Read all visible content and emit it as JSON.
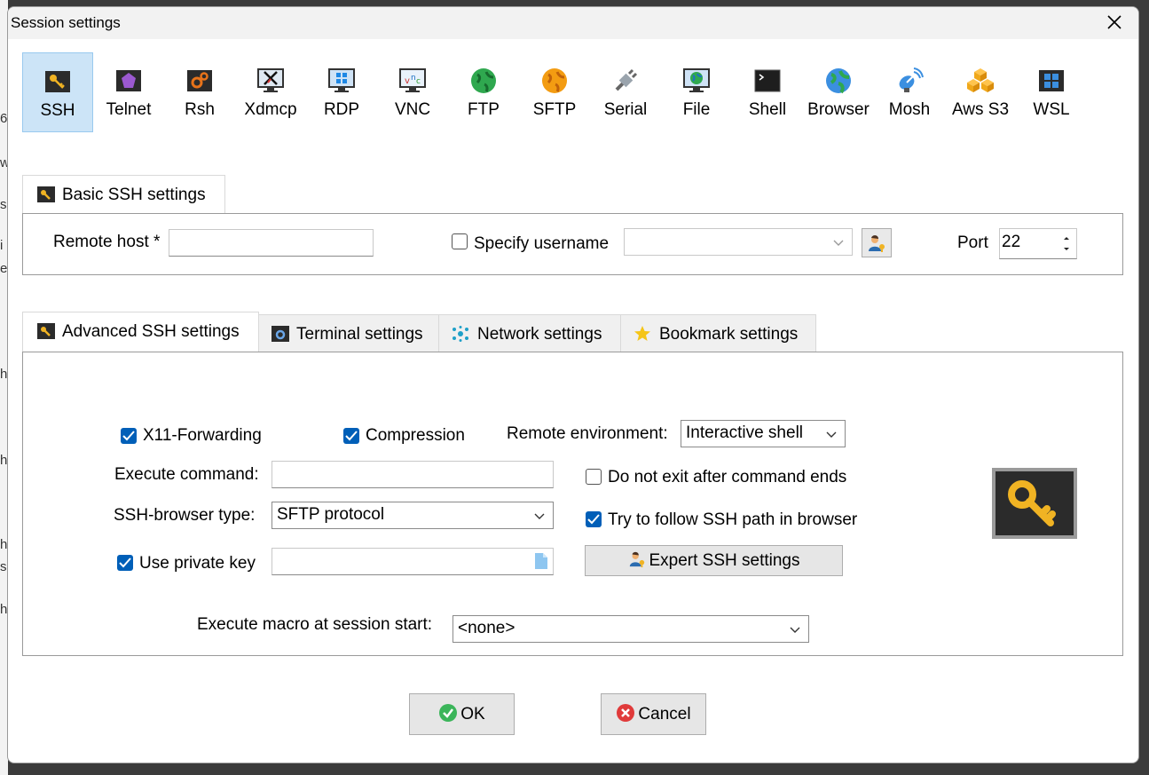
{
  "background": {
    "fragments": [
      "6",
      "w",
      "s",
      "i",
      "e",
      "h",
      "h",
      "h",
      "s",
      "h"
    ]
  },
  "dialog": {
    "title": "Session settings"
  },
  "protocols": [
    {
      "label": "SSH",
      "icon": "ssh-key-icon",
      "selected": true
    },
    {
      "label": "Telnet",
      "icon": "telnet-icon"
    },
    {
      "label": "Rsh",
      "icon": "rsh-icon"
    },
    {
      "label": "Xdmcp",
      "icon": "xdmcp-icon"
    },
    {
      "label": "RDP",
      "icon": "rdp-icon"
    },
    {
      "label": "VNC",
      "icon": "vnc-icon"
    },
    {
      "label": "FTP",
      "icon": "ftp-globe-icon"
    },
    {
      "label": "SFTP",
      "icon": "sftp-globe-icon"
    },
    {
      "label": "Serial",
      "icon": "serial-plug-icon"
    },
    {
      "label": "File",
      "icon": "file-monitor-icon"
    },
    {
      "label": "Shell",
      "icon": "shell-terminal-icon"
    },
    {
      "label": "Browser",
      "icon": "browser-globe-icon"
    },
    {
      "label": "Mosh",
      "icon": "mosh-satellite-icon"
    },
    {
      "label": "Aws S3",
      "icon": "aws-s3-icon"
    },
    {
      "label": "WSL",
      "icon": "wsl-windows-icon"
    }
  ],
  "basic": {
    "tab_label": "Basic SSH settings",
    "remote_host_label": "Remote host *",
    "remote_host_value": "",
    "specify_username_label": "Specify username",
    "specify_username_checked": false,
    "username_value": "",
    "port_label": "Port",
    "port_value": "22"
  },
  "tabs": [
    {
      "label": "Advanced SSH settings",
      "active": true
    },
    {
      "label": "Terminal settings"
    },
    {
      "label": "Network settings"
    },
    {
      "label": "Bookmark settings"
    }
  ],
  "advanced": {
    "x11_label": "X11-Forwarding",
    "x11_checked": true,
    "compression_label": "Compression",
    "compression_checked": true,
    "remote_env_label": "Remote environment:",
    "remote_env_value": "Interactive shell",
    "execute_command_label": "Execute command:",
    "execute_command_value": "",
    "no_exit_label": "Do not exit after command ends",
    "no_exit_checked": false,
    "browser_type_label": "SSH-browser type:",
    "browser_type_value": "SFTP protocol",
    "follow_path_label": "Try to follow SSH path in browser",
    "follow_path_checked": true,
    "private_key_label": "Use private key",
    "private_key_checked": true,
    "private_key_value": "",
    "expert_button": "Expert SSH settings",
    "macro_label": "Execute macro at session start:",
    "macro_value": "<none>"
  },
  "buttons": {
    "ok": "OK",
    "cancel": "Cancel"
  },
  "colors": {
    "accent": "#005fb8",
    "selected_bg": "#cce4f7",
    "key_gold": "#f0b323"
  }
}
